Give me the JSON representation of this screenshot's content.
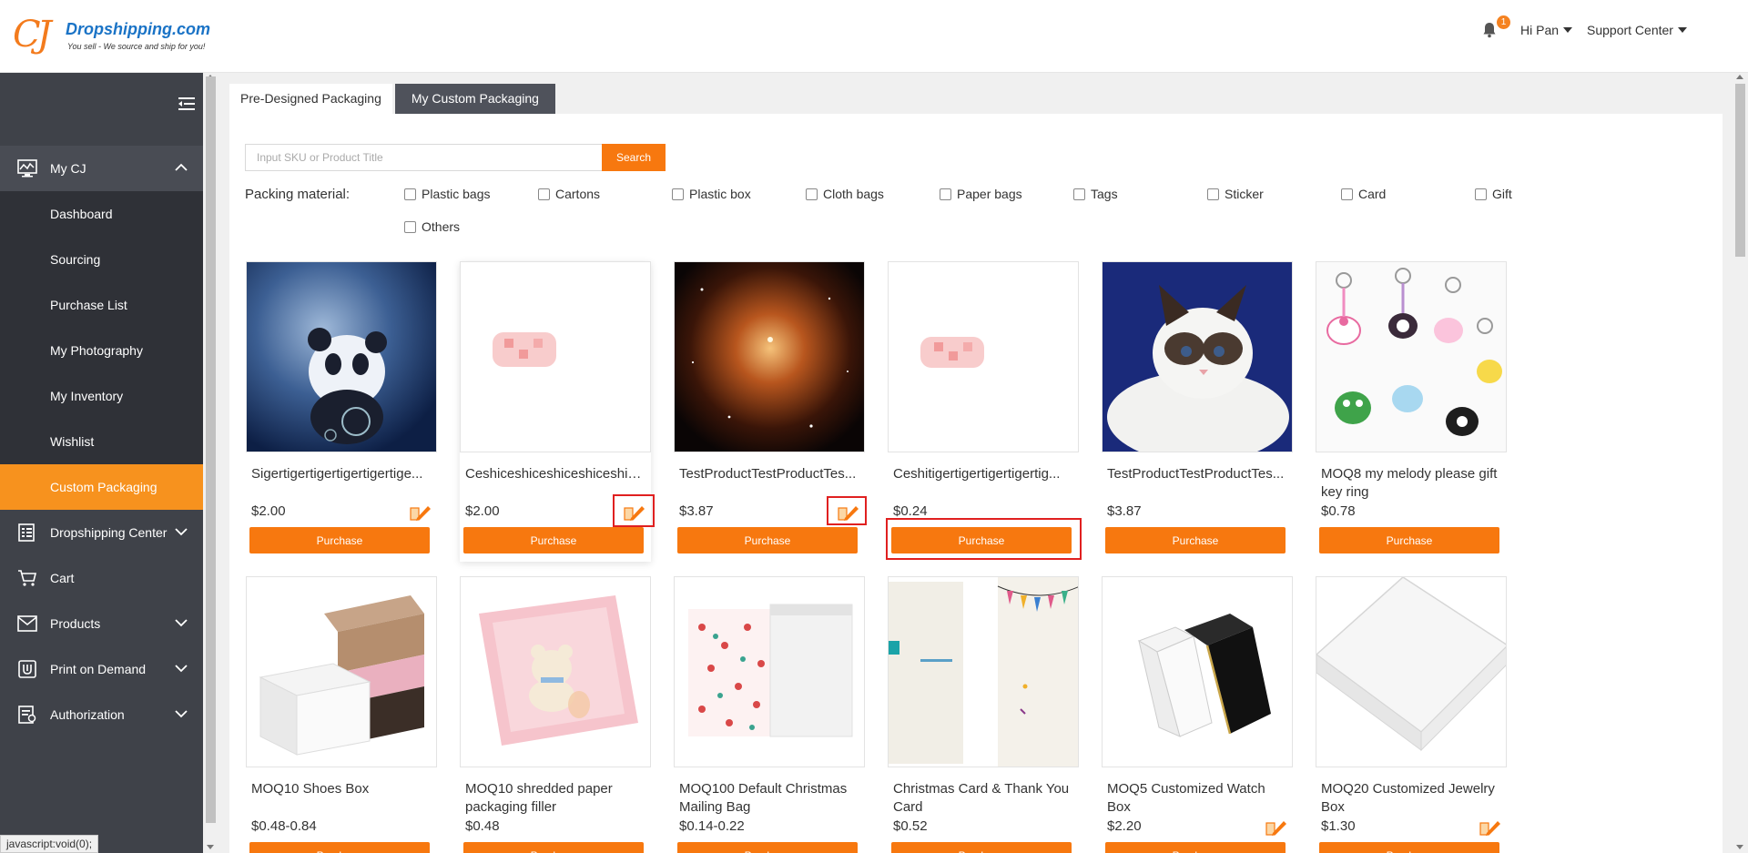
{
  "header": {
    "logo": {
      "name": "Dropshipping.com",
      "tagline": "You sell - We source and ship for you!"
    },
    "notifications_count": "1",
    "user_label": "Hi Pan",
    "support_label": "Support Center"
  },
  "sidebar": {
    "items": [
      {
        "label": "My CJ",
        "icon": "monitor-chart-icon",
        "expanded": true
      },
      {
        "label": "Dropshipping Center",
        "icon": "document-list-icon"
      },
      {
        "label": "Cart",
        "icon": "cart-icon"
      },
      {
        "label": "Products",
        "icon": "envelope-product-icon"
      },
      {
        "label": "Print on Demand",
        "icon": "pod-shield-icon"
      },
      {
        "label": "Authorization",
        "icon": "authorization-doc-icon"
      }
    ],
    "sub_items": [
      "Dashboard",
      "Sourcing",
      "Purchase List",
      "My Photography",
      "My Inventory",
      "Wishlist",
      "Custom Packaging"
    ],
    "active": "Custom Packaging"
  },
  "tabs": [
    {
      "label": "Pre-Designed Packaging",
      "active": false
    },
    {
      "label": "My Custom Packaging",
      "active": true
    }
  ],
  "search": {
    "placeholder": "Input SKU or Product Title",
    "button": "Search"
  },
  "filters": {
    "label": "Packing material:",
    "options": [
      "Plastic bags",
      "Cartons",
      "Plastic box",
      "Cloth bags",
      "Paper bags",
      "Tags",
      "Sticker",
      "Card",
      "Gift",
      "Others"
    ]
  },
  "purchase_label": "Purchase",
  "products": [
    {
      "title": "Sigertigertigertigertigertige...",
      "price": "$2.00",
      "edit_icon": true
    },
    {
      "title": "Ceshiceshiceshiceshiceshice...",
      "price": "$2.00",
      "edit_icon": true
    },
    {
      "title": "TestProductTestProductTes...",
      "price": "$3.87",
      "edit_icon": true
    },
    {
      "title": "Ceshitigertigertigertigertig...",
      "price": "$0.24",
      "edit_icon": false
    },
    {
      "title": "TestProductTestProductTes...",
      "price": "$3.87",
      "edit_icon": false
    },
    {
      "title": "MOQ8 my melody please gift key ring",
      "price": "$0.78",
      "edit_icon": false
    },
    {
      "title": "MOQ10 Shoes Box",
      "price": "$0.48-0.84",
      "edit_icon": false
    },
    {
      "title": "MOQ10 shredded paper packaging filler",
      "price": "$0.48",
      "edit_icon": false
    },
    {
      "title": "MOQ100 Default Christmas Mailing Bag",
      "price": "$0.14-0.22",
      "edit_icon": false
    },
    {
      "title": "Christmas Card & Thank You Card",
      "price": "$0.52",
      "edit_icon": false
    },
    {
      "title": "MOQ5 Customized Watch Box",
      "price": "$2.20",
      "edit_icon": true
    },
    {
      "title": "MOQ20 Customized Jewelry Box",
      "price": "$1.30",
      "edit_icon": true
    }
  ],
  "status_bar": "javascript:void(0);",
  "colors": {
    "accent": "#f7780f",
    "sidebar": "#3f4249",
    "active_nav": "#f7921e",
    "highlight": "#e02020"
  }
}
